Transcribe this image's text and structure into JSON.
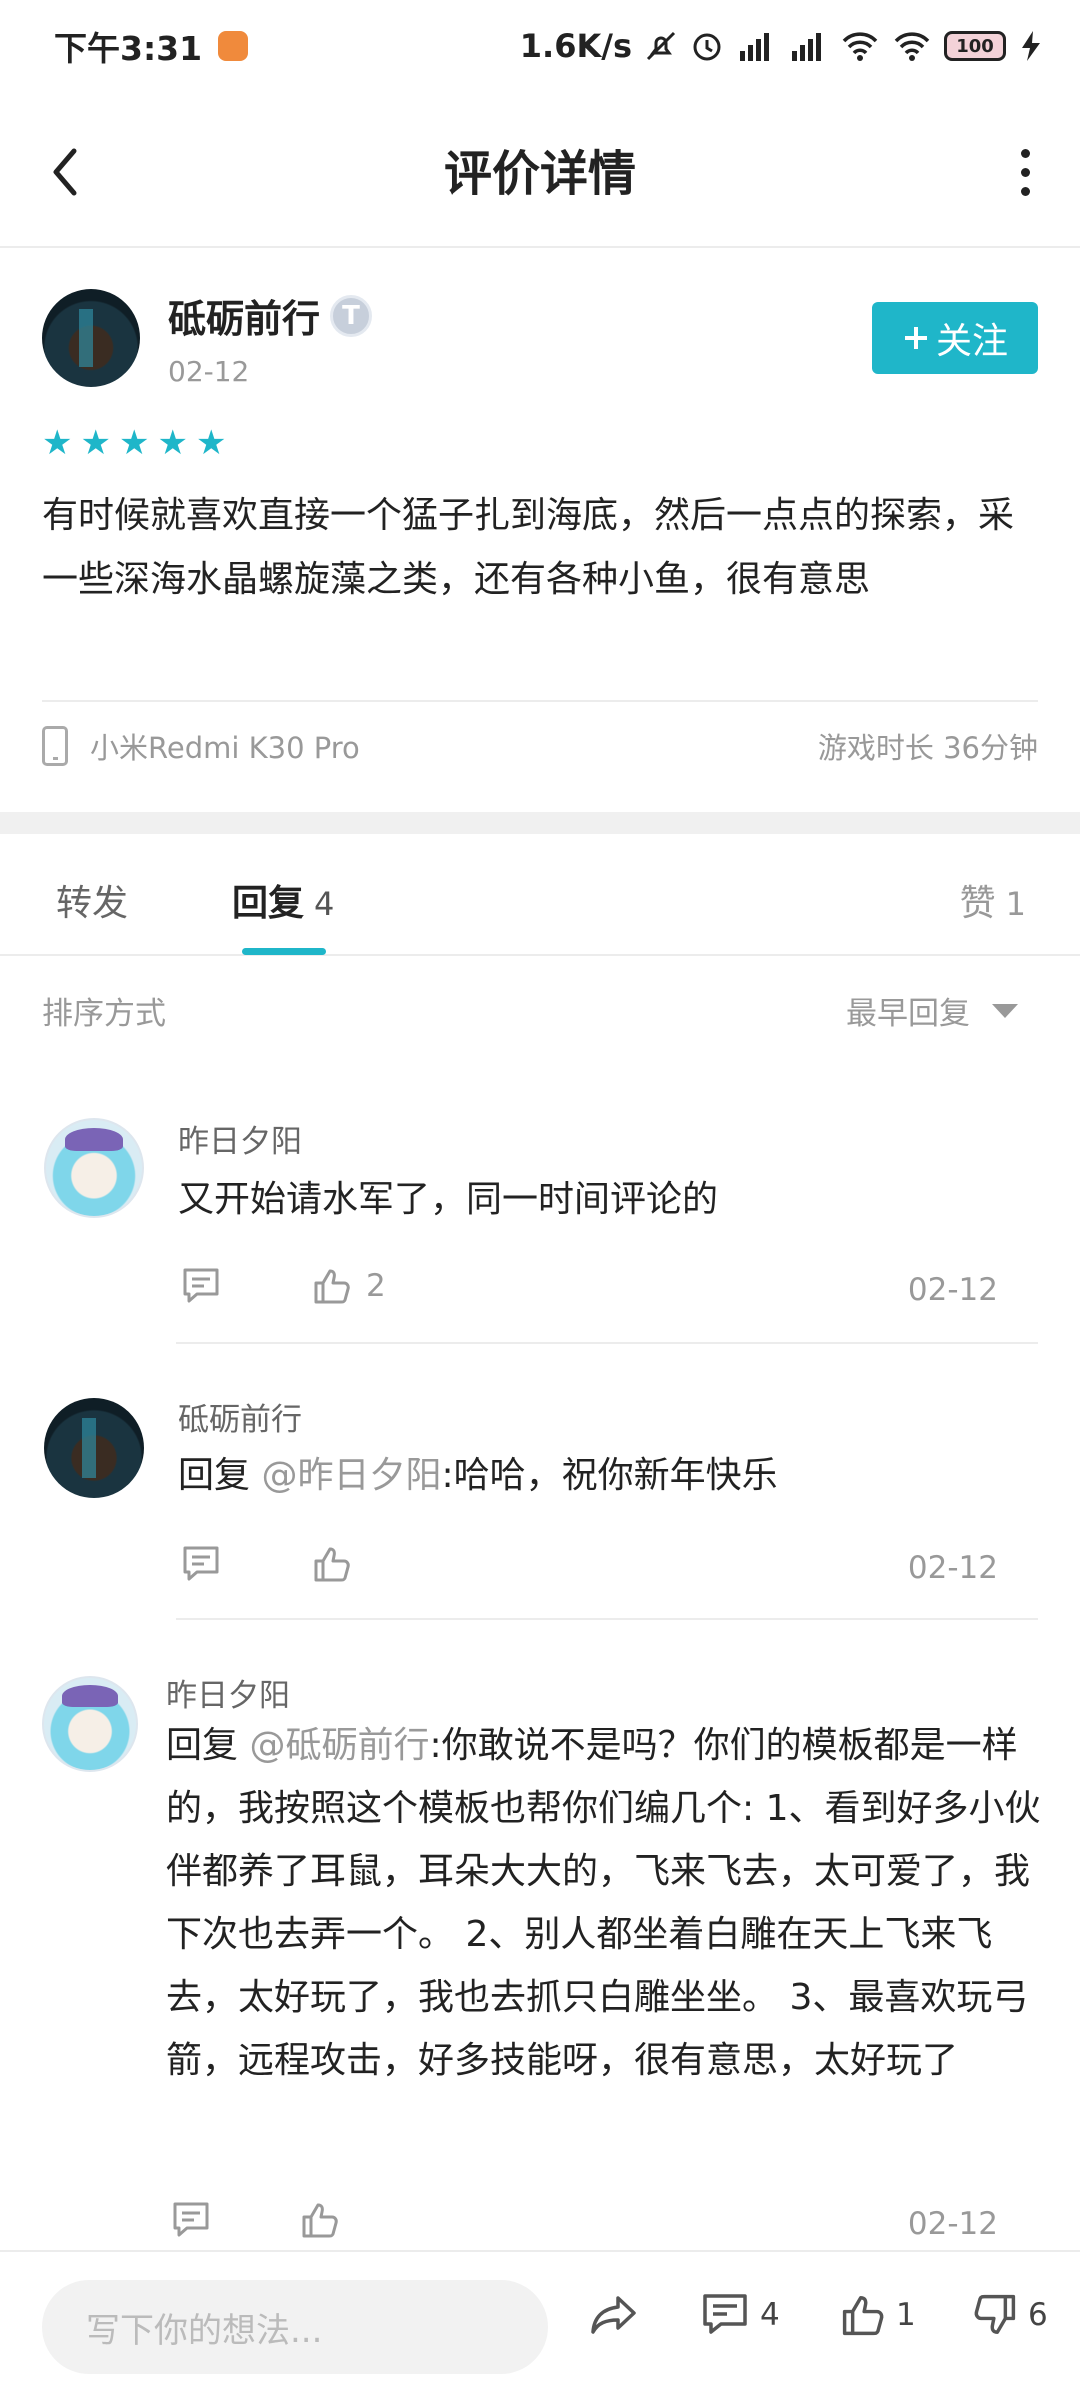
{
  "status_bar": {
    "time": "下午3:31",
    "net_speed": "1.6K/s",
    "battery": "100"
  },
  "header": {
    "title": "评价详情"
  },
  "review": {
    "author": "砥砺前行",
    "badge": "T",
    "date": "02-12",
    "follow_label": "关注",
    "stars": 5,
    "content": "有时候就喜欢直接一个猛子扎到海底，然后一点点的探索，采一些深海水晶螺旋藻之类，还有各种小鱼，很有意思",
    "device": "小米Redmi K30 Pro",
    "playtime": "游戏时长 36分钟"
  },
  "tabs": {
    "repost_label": "转发",
    "reply_label": "回复",
    "reply_count": "4",
    "like_label": "赞",
    "like_count": "1"
  },
  "sort": {
    "label": "排序方式",
    "value": "最早回复"
  },
  "replies": [
    {
      "name": "昨日夕阳",
      "text": "又开始请水军了，同一时间评论的",
      "likes": "2",
      "date": "02-12"
    },
    {
      "name": "砥砺前行",
      "prefix": "回复 ",
      "mention": "@昨日夕阳",
      "text": ":哈哈，祝你新年快乐",
      "likes": "",
      "date": "02-12"
    },
    {
      "name": "昨日夕阳",
      "prefix": "回复 ",
      "mention": "@砥砺前行",
      "text": ":你敢说不是吗？你们的模板都是一样的，我按照这个模板也帮你们编几个: 1、看到好多小伙伴都养了耳鼠，耳朵大大的，飞来飞去，太可爱了，我下次也去弄一个。 2、别人都坐着白雕在天上飞来飞去，太好玩了，我也去抓只白雕坐坐。 3、最喜欢玩弓箭，远程攻击，好多技能呀，很有意思，太好玩了",
      "likes": "",
      "date": "02-12"
    }
  ],
  "bottom_bar": {
    "input_placeholder": "写下你的想法...",
    "comment_count": "4",
    "like_count": "1",
    "dislike_count": "6"
  },
  "colors": {
    "accent": "#1fb6c9",
    "muted_text": "#999999",
    "divider": "#ececec"
  }
}
